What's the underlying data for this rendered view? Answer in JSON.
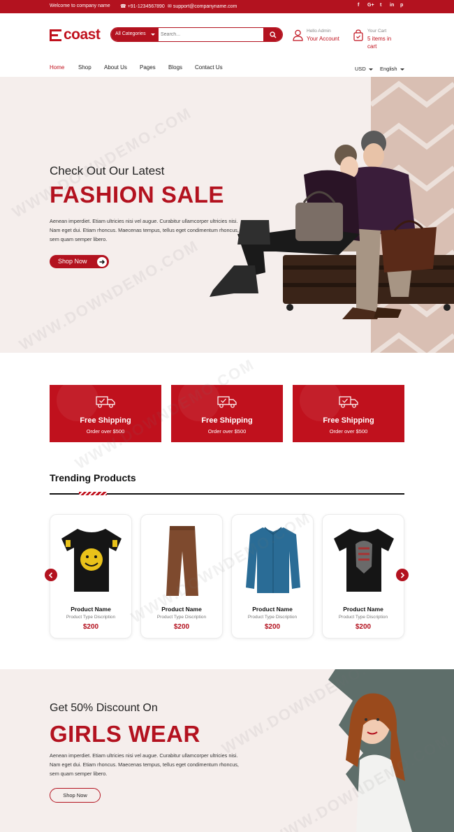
{
  "topbar": {
    "welcome": "Welcome to company name",
    "phone": "+91-1234567890",
    "email": "support@companyname.com",
    "social": [
      "f",
      "G+",
      "t",
      "in",
      "p"
    ]
  },
  "header": {
    "logo_text": "coast",
    "search": {
      "category": "All Categories",
      "placeholder": "Search..."
    },
    "account": {
      "greeting": "Hello Admin",
      "label": "Your Account"
    },
    "cart": {
      "label": "Your Cart",
      "items_line1": "5 items in",
      "items_line2": "cart"
    }
  },
  "nav": {
    "items": [
      {
        "label": "Home",
        "active": true
      },
      {
        "label": "Shop"
      },
      {
        "label": "About Us"
      },
      {
        "label": "Pages"
      },
      {
        "label": "Blogs"
      },
      {
        "label": "Contact Us"
      }
    ],
    "currency": "USD",
    "language": "English"
  },
  "hero": {
    "subtitle": "Check Out Our Latest",
    "title": "FASHION SALE",
    "description": "Aenean imperdiet. Etiam ultricies nisi vel augue. Curabitur ullamcorper ultricies nisi. Nam eget dui. Etiam rhoncus. Maecenas tempus, tellus eget condimentum rhoncus, sem quam semper libero.",
    "button": "Shop Now"
  },
  "features": [
    {
      "title": "Free Shipping",
      "subtitle": "Order over $500",
      "icon": "truck-icon"
    },
    {
      "title": "Free Shipping",
      "subtitle": "Order over $500",
      "icon": "truck-icon"
    },
    {
      "title": "Free Shipping",
      "subtitle": "Order over $500",
      "icon": "truck-icon"
    }
  ],
  "trending": {
    "title": "Trending Products",
    "products": [
      {
        "name": "Product Name",
        "description": "Product Type Discription",
        "price": "$200",
        "image": "black-tshirt-smiley"
      },
      {
        "name": "Product Name",
        "description": "Product Type Discription",
        "price": "$200",
        "image": "brown-pants"
      },
      {
        "name": "Product Name",
        "description": "Product Type Discription",
        "price": "$200",
        "image": "blue-shirt"
      },
      {
        "name": "Product Name",
        "description": "Product Type Discription",
        "price": "$200",
        "image": "black-tshirt-print"
      }
    ]
  },
  "promo": {
    "subtitle": "Get 50% Discount On",
    "title": "GIRLS WEAR",
    "description": "Aenean imperdiet. Etiam ultricies nisi vel augue. Curabitur ullamcorper ultricies nisi. Nam eget dui. Etiam rhoncus. Maecenas tempus, tellus eget condimentum rhoncus, sem quam semper libero.",
    "button": "Shop Now"
  },
  "watermark": "WWW.DOWNDEMO.COM",
  "colors": {
    "brand": "#b3121f",
    "hero_bg": "#f5eeec",
    "stripe": "#d9bfb3"
  }
}
